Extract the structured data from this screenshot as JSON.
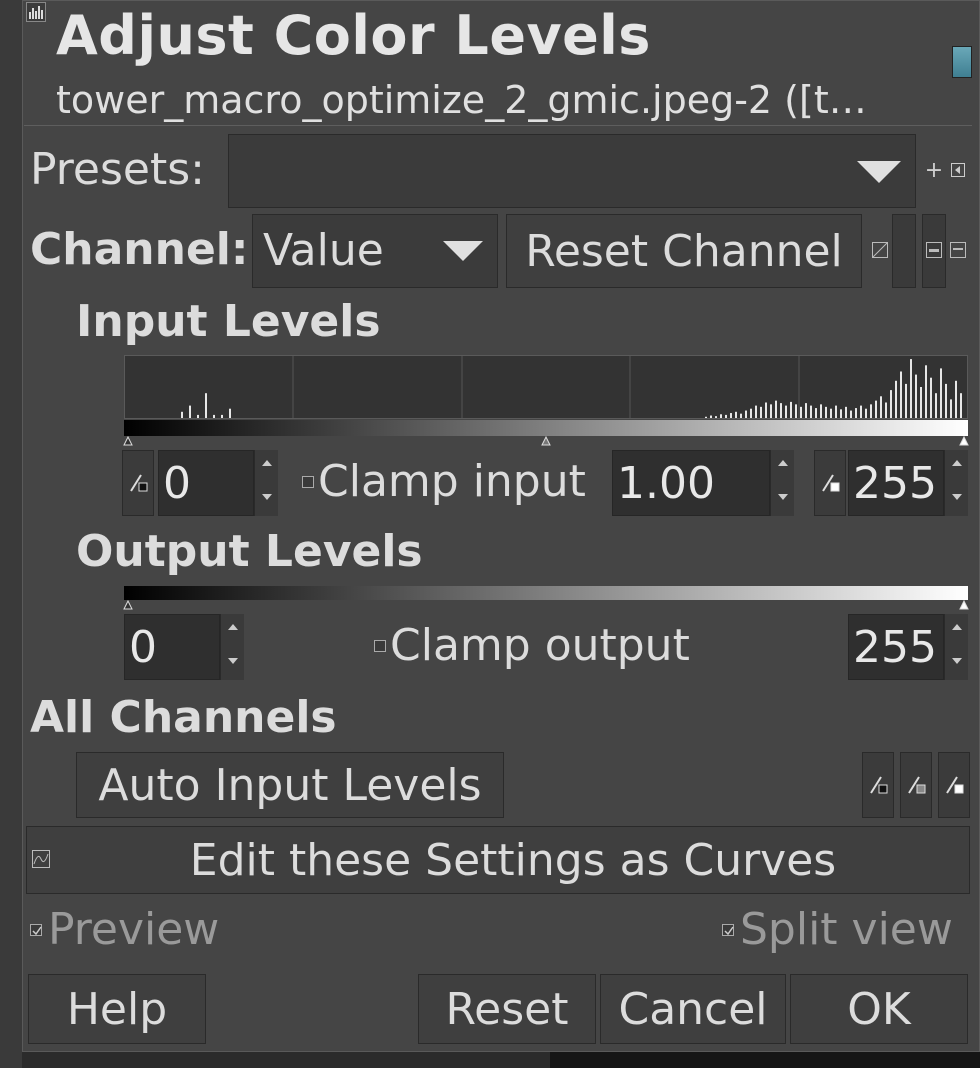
{
  "window": {
    "title": "Adjust Color Levels",
    "subtitle": "tower_macro_optimize_2_gmic.jpeg-2 ([t…"
  },
  "presets": {
    "label": "Presets:",
    "value": ""
  },
  "channel": {
    "label": "Channel:",
    "value": "Value",
    "reset_label": "Reset Channel"
  },
  "input_levels": {
    "heading": "Input Levels",
    "low": "0",
    "clamp_label": "Clamp input",
    "gamma": "1.00",
    "high": "255",
    "histogram": {
      "low_bins": [
        0.1,
        0.2,
        0.05,
        0.4,
        0.05,
        0.05,
        0.15
      ],
      "high_bins": [
        0.02,
        0.04,
        0.03,
        0.06,
        0.05,
        0.08,
        0.1,
        0.07,
        0.12,
        0.15,
        0.2,
        0.18,
        0.25,
        0.22,
        0.28,
        0.24,
        0.2,
        0.26,
        0.22,
        0.18,
        0.24,
        0.2,
        0.16,
        0.22,
        0.18,
        0.15,
        0.2,
        0.14,
        0.18,
        0.12,
        0.16,
        0.2,
        0.15,
        0.22,
        0.28,
        0.35,
        0.25,
        0.45,
        0.6,
        0.75,
        0.55,
        0.95,
        0.7,
        0.5,
        0.85,
        0.65,
        0.4,
        0.8,
        0.55,
        0.3,
        0.6,
        0.4
      ]
    }
  },
  "output_levels": {
    "heading": "Output Levels",
    "low": "0",
    "clamp_label": "Clamp output",
    "high": "255"
  },
  "all_channels": {
    "heading": "All Channels",
    "auto_label": "Auto Input Levels"
  },
  "curves_label": "Edit these Settings as Curves",
  "preview_label": "Preview",
  "split_label": "Split view",
  "buttons": {
    "help": "Help",
    "reset": "Reset",
    "cancel": "Cancel",
    "ok": "OK"
  },
  "colors": {
    "dialog_bg": "#454545",
    "entry_bg": "#2f2f2f",
    "text": "#dcdcdc"
  }
}
